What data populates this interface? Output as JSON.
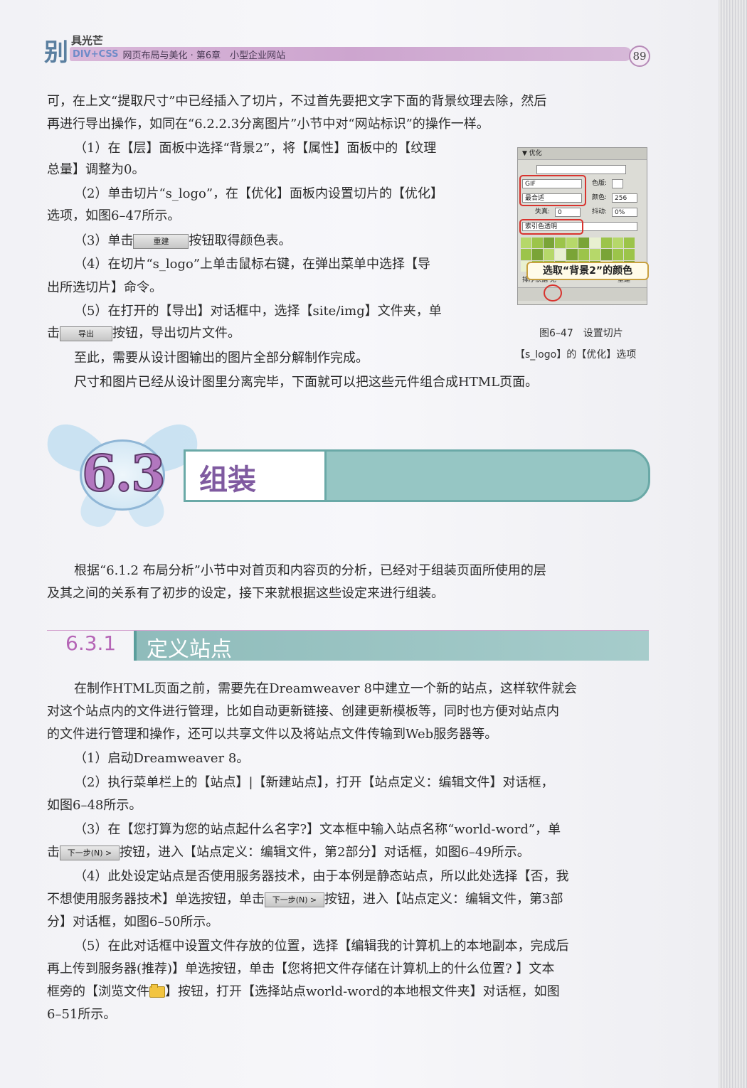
{
  "header": {
    "logo_main": "别",
    "logo_small": "具光芒",
    "series": "DIV+CSS",
    "chapter": "网页布局与美化 · 第6章　小型企业网站",
    "page_number": "89"
  },
  "intro": {
    "line1": "可，在上文“提取尺寸”中已经插入了切片，不过首先要把文字下面的背景纹理去除，然后",
    "line2": "再进行导出操作，如同在“6.2.2.3分离图片”小节中对“网站标识”的操作一样。"
  },
  "steps1": {
    "s1a": "（1）在【层】面板中选择“背景2”，将【属性】面板中的【纹理",
    "s1b": "总量】调整为0。",
    "s2a": "（2）单击切片“s_logo”，在【优化】面板内设置切片的【优化】",
    "s2b": "选项，如图6–47所示。",
    "s3_before": "（3）单击",
    "s3_button": "重建",
    "s3_after": "按钮取得颜色表。",
    "s4a": "（4）在切片“s_logo”上单击鼠标右键，在弹出菜单中选择【导",
    "s4b": "出所选切片】命令。",
    "s5a": "（5）在打开的【导出】对话框中，选择【site/img】文件夹，单",
    "s5b_before": "击",
    "s5b_button": "导出",
    "s5b_after": "按钮，导出切片文件。",
    "p6": "至此，需要从设计图输出的图片全部分解制作完成。",
    "p7": "尺寸和图片已经从设计图里分离完毕，下面就可以把这些元件组合成HTML页面。"
  },
  "figure": {
    "panel_title": "▼ 优化",
    "format": "GIF",
    "palette": "最合适",
    "matte_label": "色版:",
    "colors_label": "颜色:",
    "colors_value": "256",
    "loss_label": "失真:",
    "loss_value": "0",
    "dither_label": "抖动:",
    "dither_value": "0%",
    "transparency": "索引色透明",
    "sort_label": "排序依据",
    "sort_value": "无",
    "rebuild_label": "重建",
    "callout": "选取“背景2”的颜色",
    "caption1": "图6–47　设置切片",
    "caption2": "【s_logo】的【优化】选项"
  },
  "section": {
    "number": "6.3",
    "title": "组装",
    "para1a": "根据“6.1.2 布局分析”小节中对首页和内容页的分析，已经对于组装页面所使用的层",
    "para1b": "及其之间的关系有了初步的设定，接下来就根据这些设定来进行组装。"
  },
  "subsection": {
    "number": "6.3.1",
    "title": "定义站点",
    "p1a": "在制作HTML页面之前，需要先在Dreamweaver 8中建立一个新的站点，这样软件就会",
    "p1b": "对这个站点内的文件进行管理，比如自动更新链接、创建更新模板等，同时也方便对站点内",
    "p1c": "的文件进行管理和操作，还可以共享文件以及将站点文件传输到Web服务器等。",
    "s1": "（1）启动Dreamweaver 8。",
    "s2a": "（2）执行菜单栏上的【站点】|【新建站点】，打开【站点定义：编辑文件】对话框，",
    "s2b": "如图6–48所示。",
    "s3a": "（3）在【您打算为您的站点起什么名字?】文本框中输入站点名称“world-word”，单",
    "s3b_before": "击",
    "next_button": "下一步(N) >",
    "s3b_after": "按钮，进入【站点定义：编辑文件，第2部分】对话框，如图6–49所示。",
    "s4a": "（4）此处设定站点是否使用服务器技术，由于本例是静态站点，所以此处选择【否，我",
    "s4b_before": "不想使用服务器技术】单选按钮，单击",
    "s4b_after": "按钮，进入【站点定义：编辑文件，第3部",
    "s4c": "分】对话框，如图6–50所示。",
    "s5a": "（5）在此对话框中设置文件存放的位置，选择【编辑我的计算机上的本地副本，完成后",
    "s5b": "再上传到服务器(推荐)】单选按钮，单击【您将把文件存储在计算机上的什么位置? 】文本",
    "s5c_before": "框旁的【浏览文件",
    "s5c_after": "】按钮，打开【选择站点world-word的本地根文件夹】对话框，如图",
    "s5d": "6–51所示。"
  }
}
